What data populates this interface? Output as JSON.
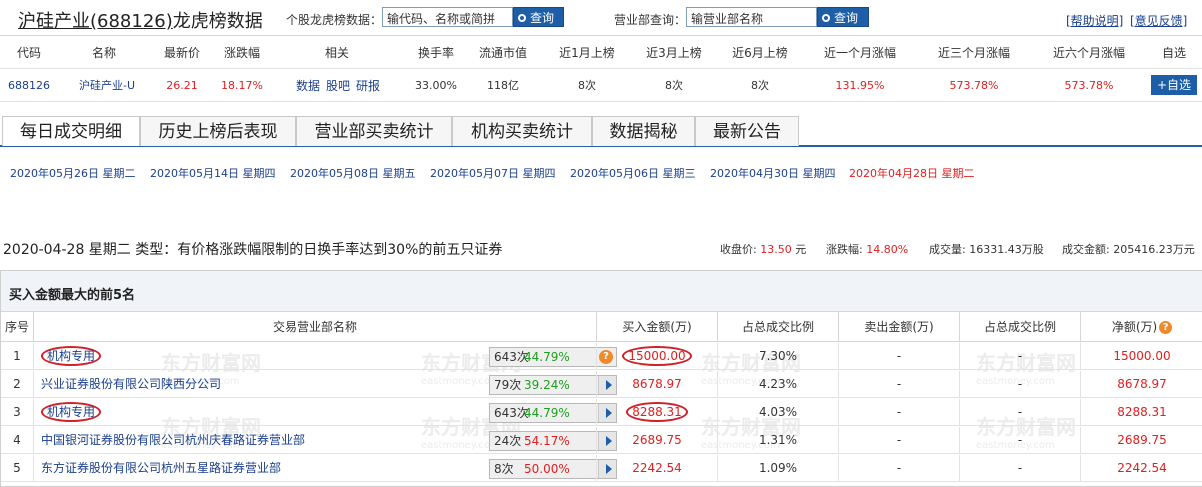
{
  "header": {
    "title_name": "沪硅产业",
    "title_code": "(688126)",
    "title_suffix": "龙虎榜数据",
    "stock_search_label": "个股龙虎榜数据：",
    "stock_search_placeholder": "输代码、名称或简拼",
    "query_btn": "查询",
    "branch_search_label": "营业部查询：",
    "branch_search_placeholder": "输营业部名称",
    "help": "[帮助说明]",
    "feedback": "[意见反馈]"
  },
  "quote": {
    "headers": [
      "代码",
      "名称",
      "最新价",
      "涨跌幅",
      "相关",
      "换手率",
      "流通市值",
      "近1月上榜",
      "近3月上榜",
      "近6月上榜",
      "近一个月涨幅",
      "近三个月涨幅",
      "近六个月涨幅",
      "自选"
    ],
    "code": "688126",
    "name": "沪硅产业-U",
    "price": "26.21",
    "change": "18.17%",
    "links": [
      "数据",
      "股吧",
      "研报"
    ],
    "turnover": "33.00%",
    "float_cap": "118亿",
    "m1": "8次",
    "m3": "8次",
    "m6": "8次",
    "rise1": "131.95%",
    "rise3": "573.78%",
    "rise6": "573.78%",
    "add_btn": "+自选"
  },
  "tabs": [
    "每日成交明细",
    "历史上榜后表现",
    "营业部买卖统计",
    "机构买卖统计",
    "数据揭秘",
    "最新公告"
  ],
  "dates": [
    "2020年05月26日 星期二",
    "2020年05月14日 星期四",
    "2020年05月08日 星期五",
    "2020年05月07日 星期四",
    "2020年05月06日 星期三",
    "2020年04月30日 星期四",
    "2020年04月28日 星期二"
  ],
  "summary": {
    "text": "2020-04-28 星期二 类型：有价格涨跌幅限制的日换手率达到30%的前五只证券",
    "close_label": "收盘价:",
    "close_value": "13.50",
    "close_unit": "元",
    "change_label": "涨跌幅:",
    "change_value": "14.80%",
    "volume_label": "成交量:",
    "volume_value": "16331.43万股",
    "amount_label": "成交金额:",
    "amount_value": "205416.23万元"
  },
  "table": {
    "title": "买入金额最大的前5名",
    "headers": [
      "序号",
      "交易营业部名称",
      "买入金额(万)",
      "占总成交比例",
      "卖出金额(万)",
      "占总成交比例",
      "净额(万)"
    ],
    "rows": [
      {
        "idx": "1",
        "name": "机构专用",
        "count": "643次",
        "pct": "44.79%",
        "buy": "15000.00",
        "buy_ratio": "7.30%",
        "sell": "-",
        "sell_ratio": "-",
        "net": "15000.00"
      },
      {
        "idx": "2",
        "name": "兴业证券股份有限公司陕西分公司",
        "count": "79次",
        "pct": "39.24%",
        "buy": "8678.97",
        "buy_ratio": "4.23%",
        "sell": "-",
        "sell_ratio": "-",
        "net": "8678.97"
      },
      {
        "idx": "3",
        "name": "机构专用",
        "count": "643次",
        "pct": "44.79%",
        "buy": "8288.31",
        "buy_ratio": "4.03%",
        "sell": "-",
        "sell_ratio": "-",
        "net": "8288.31"
      },
      {
        "idx": "4",
        "name": "中国银河证券股份有限公司杭州庆春路证券营业部",
        "count": "24次",
        "pct": "54.17%",
        "buy": "2689.75",
        "buy_ratio": "1.31%",
        "sell": "-",
        "sell_ratio": "-",
        "net": "2689.75"
      },
      {
        "idx": "5",
        "name": "东方证券股份有限公司杭州五星路证券营业部",
        "count": "8次",
        "pct": "50.00%",
        "buy": "2242.54",
        "buy_ratio": "1.09%",
        "sell": "-",
        "sell_ratio": "-",
        "net": "2242.54"
      }
    ]
  },
  "watermark": {
    "cn": "东方财富网",
    "en": "eastmoney.com"
  },
  "colors": {
    "accent": "#1d5ea7",
    "up": "#e02020",
    "link": "#1a3f8c",
    "pct_green": "#1e9e1e",
    "help_orange": "#f0892a"
  }
}
